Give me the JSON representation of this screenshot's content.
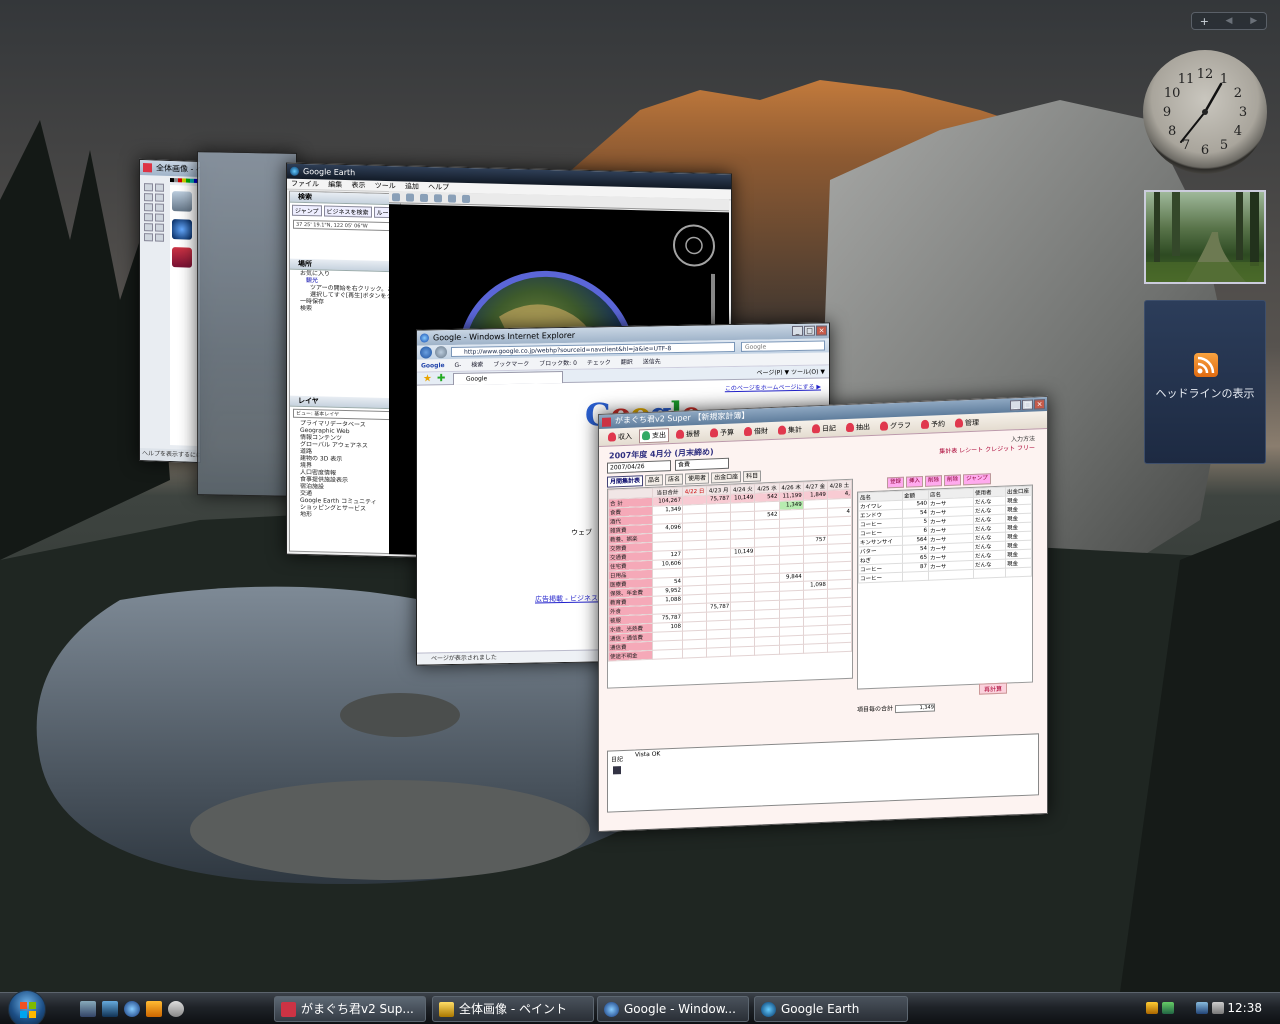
{
  "desktop": {
    "sidebar": {
      "add_label": "+",
      "prev_label": "◀",
      "next_label": "▶",
      "feed_label": "ヘッドラインの表示"
    },
    "clock_numbers": [
      "12",
      "1",
      "2",
      "3",
      "4",
      "5",
      "6",
      "7",
      "8",
      "9",
      "10",
      "11"
    ]
  },
  "paint": {
    "title": "全体画像 - ペイント",
    "status": "ヘルプを表示するには、[ヘルプ]"
  },
  "earth": {
    "title": "Google Earth",
    "menu": [
      "ファイル",
      "編集",
      "表示",
      "ツール",
      "追加",
      "ヘルプ"
    ],
    "search_header": "検索",
    "tabs": [
      "ジャンプ",
      "ビジネスを検索",
      "ルート"
    ],
    "coords": "37 25' 19.1\"N, 122 05' 06\"W",
    "places_header": "場所",
    "places": [
      "お気に入り",
      "観光",
      "ツアーの開始を右クリック。このフォルダを",
      "選択してすぐ[再生]ボタンをクリック",
      "一時保存",
      "検索"
    ],
    "layers_header": "レイヤ",
    "layer_view": "ビュー: 基本レイヤ",
    "layers": [
      "プライマリデータベース",
      "Geographic Web",
      "情報コンテンツ",
      "グローバル アウェアネス",
      "道路",
      "建物の 3D 表示",
      "境界",
      "人口密度情報",
      "食事提供施設表示",
      "宿泊施設",
      "交通",
      "Google Earth コミュニティ",
      "ショッピングとサービス",
      "地形"
    ]
  },
  "ie": {
    "title": "Google - Windows Internet Explorer",
    "url": "http://www.google.co.jp/webhp?sourceid=navclient&hl=ja&ie=UTF-8",
    "search_placeholder": "Google",
    "google_toolbar": [
      "Google",
      "G-",
      "検索",
      "ブックマーク",
      "ブロック数: 0",
      "チェック",
      "翻訳",
      "送信先"
    ],
    "tab_label": "Google",
    "tab_right": "ページ(P) ▼  ツール(O) ▼",
    "homepage_link": "このページをホームページにする ▶",
    "web_tab": "ウェブ",
    "footer_links": "広告掲載 - ビジネス ソリ",
    "status": "ページが表示されました"
  },
  "gama": {
    "title": "がまぐち君v2 Super 【新規家計簿】",
    "toolbar": [
      "収入",
      "支出",
      "振替",
      "予算",
      "借財",
      "集計",
      "日記",
      "抽出",
      "グラフ",
      "予約",
      "管理"
    ],
    "period": "2007年度 4月分 (月末締め)",
    "input_method": "入力方法",
    "input_options": "集計表  レシート  クレジット  フリー",
    "date": "2007/04/26",
    "category": "食費",
    "subtabs": [
      "月間集計表",
      "品名",
      "店名",
      "使用者",
      "出金口座",
      "科目"
    ],
    "grid_headers": [
      "",
      "当日合計",
      "4/22 日",
      "4/23 月",
      "4/24 火",
      "4/25 水",
      "4/26 木",
      "4/27 金",
      "4/28 土"
    ],
    "grid_rows": [
      [
        "合 計",
        "104,267",
        "",
        "75,787",
        "10,149",
        "542",
        "11,199",
        "1,849",
        "4,"
      ],
      [
        "食費",
        "1,349",
        "",
        "",
        "",
        "",
        "1,349",
        "",
        ""
      ],
      [
        "酒代",
        "",
        "",
        "",
        "",
        "542",
        "",
        "",
        "4"
      ],
      [
        "雑貨費",
        "4,096",
        "",
        "",
        "",
        "",
        "",
        "",
        ""
      ],
      [
        "教養、娯楽",
        "",
        "",
        "",
        "",
        "",
        "",
        "",
        ""
      ],
      [
        "交際費",
        "",
        "",
        "",
        "",
        "",
        "",
        "757",
        ""
      ],
      [
        "交通費",
        "127",
        "",
        "",
        "10,149",
        "",
        "",
        "",
        ""
      ],
      [
        "住宅費",
        "10,606",
        "",
        "",
        "",
        "",
        "",
        "",
        ""
      ],
      [
        "日用品",
        "",
        "",
        "",
        "",
        "",
        "",
        "",
        ""
      ],
      [
        "医療費",
        "54",
        "",
        "",
        "",
        "",
        "9,844",
        "",
        ""
      ],
      [
        "保険、年金費",
        "9,952",
        "",
        "",
        "",
        "",
        "",
        "1,098",
        ""
      ],
      [
        "教育費",
        "1,088",
        "",
        "",
        "",
        "",
        "",
        "",
        ""
      ],
      [
        "外食",
        "",
        "",
        "75,787",
        "",
        "",
        "",
        "",
        ""
      ],
      [
        "被服",
        "75,787",
        "",
        "",
        "",
        "",
        "",
        "",
        ""
      ],
      [
        "水道、光熱費",
        "108",
        "",
        "",
        "",
        "",
        "",
        "",
        ""
      ],
      [
        "通信・通信費",
        "",
        "",
        "",
        "",
        "",
        "",
        "",
        ""
      ],
      [
        "通信費",
        "",
        "",
        "",
        "",
        "",
        "",
        "",
        ""
      ],
      [
        "使途不明金",
        "",
        "",
        "",
        "",
        "",
        "",
        "",
        ""
      ]
    ],
    "right_tabs": [
      "登録",
      "挿入",
      "削除",
      "削除",
      "ジャンプ"
    ],
    "list_headers": [
      "品名",
      "金額",
      "店名",
      "使用者",
      "出金口座"
    ],
    "list_rows": [
      [
        "カイワレ",
        "540",
        "カーサ",
        "だんな",
        "現金"
      ],
      [
        "エンドウ",
        "54",
        "カーサ",
        "だんな",
        "現金"
      ],
      [
        "コーヒー",
        "5",
        "カーサ",
        "だんな",
        "現金"
      ],
      [
        "コーヒー",
        "6",
        "カーサ",
        "だんな",
        "現金"
      ],
      [
        "キンサンサイ",
        "564",
        "カーサ",
        "だんな",
        "現金"
      ],
      [
        "バター",
        "54",
        "カーサ",
        "だんな",
        "現金"
      ],
      [
        "ねぎ",
        "65",
        "カーサ",
        "だんな",
        "現金"
      ],
      [
        "コーヒー",
        "87",
        "カーサ",
        "だんな",
        "現金"
      ],
      [
        "コーヒー",
        "",
        "",
        "",
        ""
      ]
    ],
    "month_total_label": "項目毎の合計",
    "month_total_value": "1,349",
    "calc_label": "再計算",
    "diary_label": "日記",
    "diary_text": "Vista OK"
  },
  "taskbar": {
    "buttons": [
      "がまぐち君v2 Sup...",
      "全体画像 - ペイント",
      "Google - Window...",
      "Google Earth"
    ],
    "time": "12:38"
  }
}
